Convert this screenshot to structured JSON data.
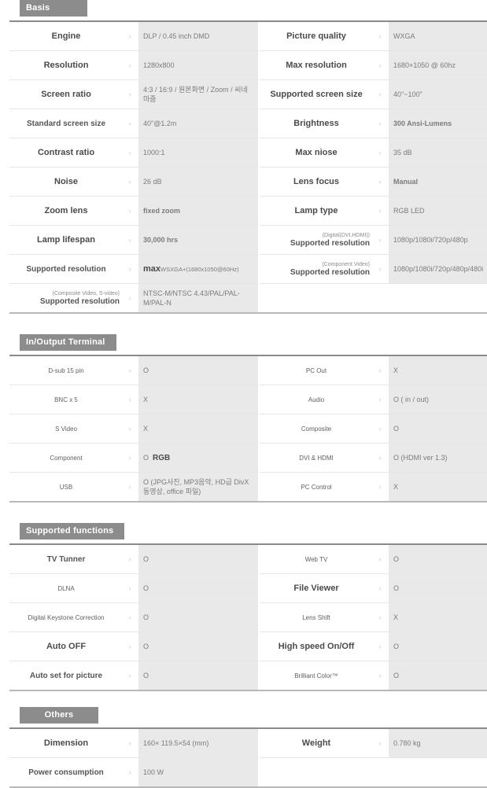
{
  "sections": [
    {
      "title": "Basis",
      "header_align": "left",
      "rows": [
        {
          "l1": "Engine",
          "v1": "DLP / 0.45 inch DMD",
          "l2": "Picture quality",
          "v2": "WXGA"
        },
        {
          "l1": "Resolution",
          "v1": "1280x800",
          "l2": "Max resolution",
          "v2": "1680×1050 @ 60hz"
        },
        {
          "l1": "Screen ratio",
          "v1": "4:3 / 16:9 / 원본화면 / Zoom / 씨네마줌",
          "l2": "Supported screen size",
          "v2": "40\"~100\""
        },
        {
          "l1": "Standard screen size",
          "v1": "40\"@1.2m",
          "l2": "Brightness",
          "v2": "300  Ansi-Lumens"
        },
        {
          "l1": "Contrast ratio",
          "v1": "1000:1",
          "l2": "Max niose",
          "v2": "35 dB"
        },
        {
          "l1": "Noise",
          "v1": "26 dB",
          "l2": "Lens focus",
          "v2": "Manual"
        },
        {
          "l1": "Zoom lens",
          "v1": "fixed zoom",
          "l2": "Lamp type",
          "v2": "RGB LED"
        },
        {
          "l1": "Lamp lifespan",
          "v1": "30,000  hrs",
          "l2sup": "(Digital(DVI,HDMI))",
          "l2": "Supported resolution",
          "v2": "1080p/1080i/720p/480p"
        },
        {
          "l1": "Supported resolution",
          "v1": "max WSXGA+(1680x1050@60Hz)",
          "l2sup": "(Component Video)",
          "l2": "Supported resolution",
          "v2": "1080p/1080i/720p/480p/480i"
        },
        {
          "l1sup": "(Composite Video, S-video)",
          "l1": "Supported resolution",
          "v1": "NTSC-M/NTSC 4.43/PAL/PAL-M/PAL-N",
          "l2": "",
          "v2": ""
        }
      ]
    },
    {
      "title": "In/Output Terminal",
      "header_align": "left",
      "rows": [
        {
          "l1": "D-sub 15 pin",
          "v1": "O",
          "l2": "PC Out",
          "v2": "X"
        },
        {
          "l1": "BNC x 5",
          "v1": "X",
          "l2": "Audio",
          "v2": "O ( in / out)"
        },
        {
          "l1": "S Video",
          "v1": "X",
          "l2": "Composite",
          "v2": "O"
        },
        {
          "l1": "Component",
          "v1": "O  RGB",
          "l2": "DVI & HDMI",
          "v2": "O (HDMI ver 1.3)"
        },
        {
          "l1": "USB",
          "v1": "O (JPG사진, MP3음악, HD급 DivX동영상, office 파일)",
          "l2": "PC Control",
          "v2": "X"
        }
      ]
    },
    {
      "title": "Supported functions",
      "header_align": "left",
      "rows": [
        {
          "l1": "TV  Tunner",
          "v1": "O",
          "l2": "Web TV",
          "v2": "O"
        },
        {
          "l1": "DLNA",
          "v1": "O",
          "l2": "File Viewer",
          "v2": "O"
        },
        {
          "l1": "Digital Keystone Correction",
          "v1": "O",
          "l2": "Lens Shift",
          "v2": "X"
        },
        {
          "l1": "Auto OFF",
          "v1": "O",
          "l2": "High speed On/Off",
          "v2": "O"
        },
        {
          "l1": "Auto set for picture",
          "v1": "O",
          "l2": "Brilliant Color™",
          "v2": "O"
        }
      ]
    },
    {
      "title": "Others",
      "header_align": "center",
      "rows": [
        {
          "l1": "Dimension",
          "v1": "160× 119.5×54 (mm)",
          "l2": "Weight",
          "v2": "0.780 kg"
        },
        {
          "l1": "Power consumption",
          "v1": "100 W",
          "l2": "",
          "v2": ""
        }
      ]
    }
  ],
  "icons": {
    "chevron": "›"
  },
  "colors": {
    "header_bg": "#8c8c8c",
    "value_bg": "#e9e9e9",
    "rule": "#8a8a8a"
  }
}
